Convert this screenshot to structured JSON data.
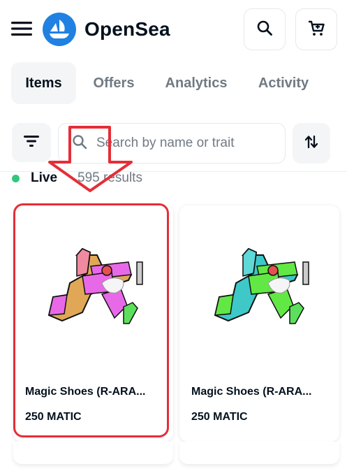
{
  "header": {
    "brand": "OpenSea",
    "icons": {
      "menu": "hamburger-menu-icon",
      "logo": "opensea-logo-icon",
      "search": "search-icon",
      "cart": "cart-icon"
    }
  },
  "tabs": [
    {
      "label": "Items",
      "active": true
    },
    {
      "label": "Offers",
      "active": false
    },
    {
      "label": "Analytics",
      "active": false
    },
    {
      "label": "Activity",
      "active": false
    }
  ],
  "search": {
    "placeholder": "Search by name or trait",
    "value": ""
  },
  "status": {
    "live_label": "Live",
    "results": "595 results",
    "live_color": "#34c77b"
  },
  "cards": [
    {
      "name": "Magic Shoes (R-ARA...",
      "price": "250 MATIC",
      "variant": "orange-pink"
    },
    {
      "name": "Magic Shoes (R-ARA...",
      "price": "250 MATIC",
      "variant": "teal-green"
    }
  ],
  "colors": {
    "accent": "#2081e2",
    "highlight": "#e52e37",
    "text": "#04111d",
    "muted": "#707a83"
  }
}
